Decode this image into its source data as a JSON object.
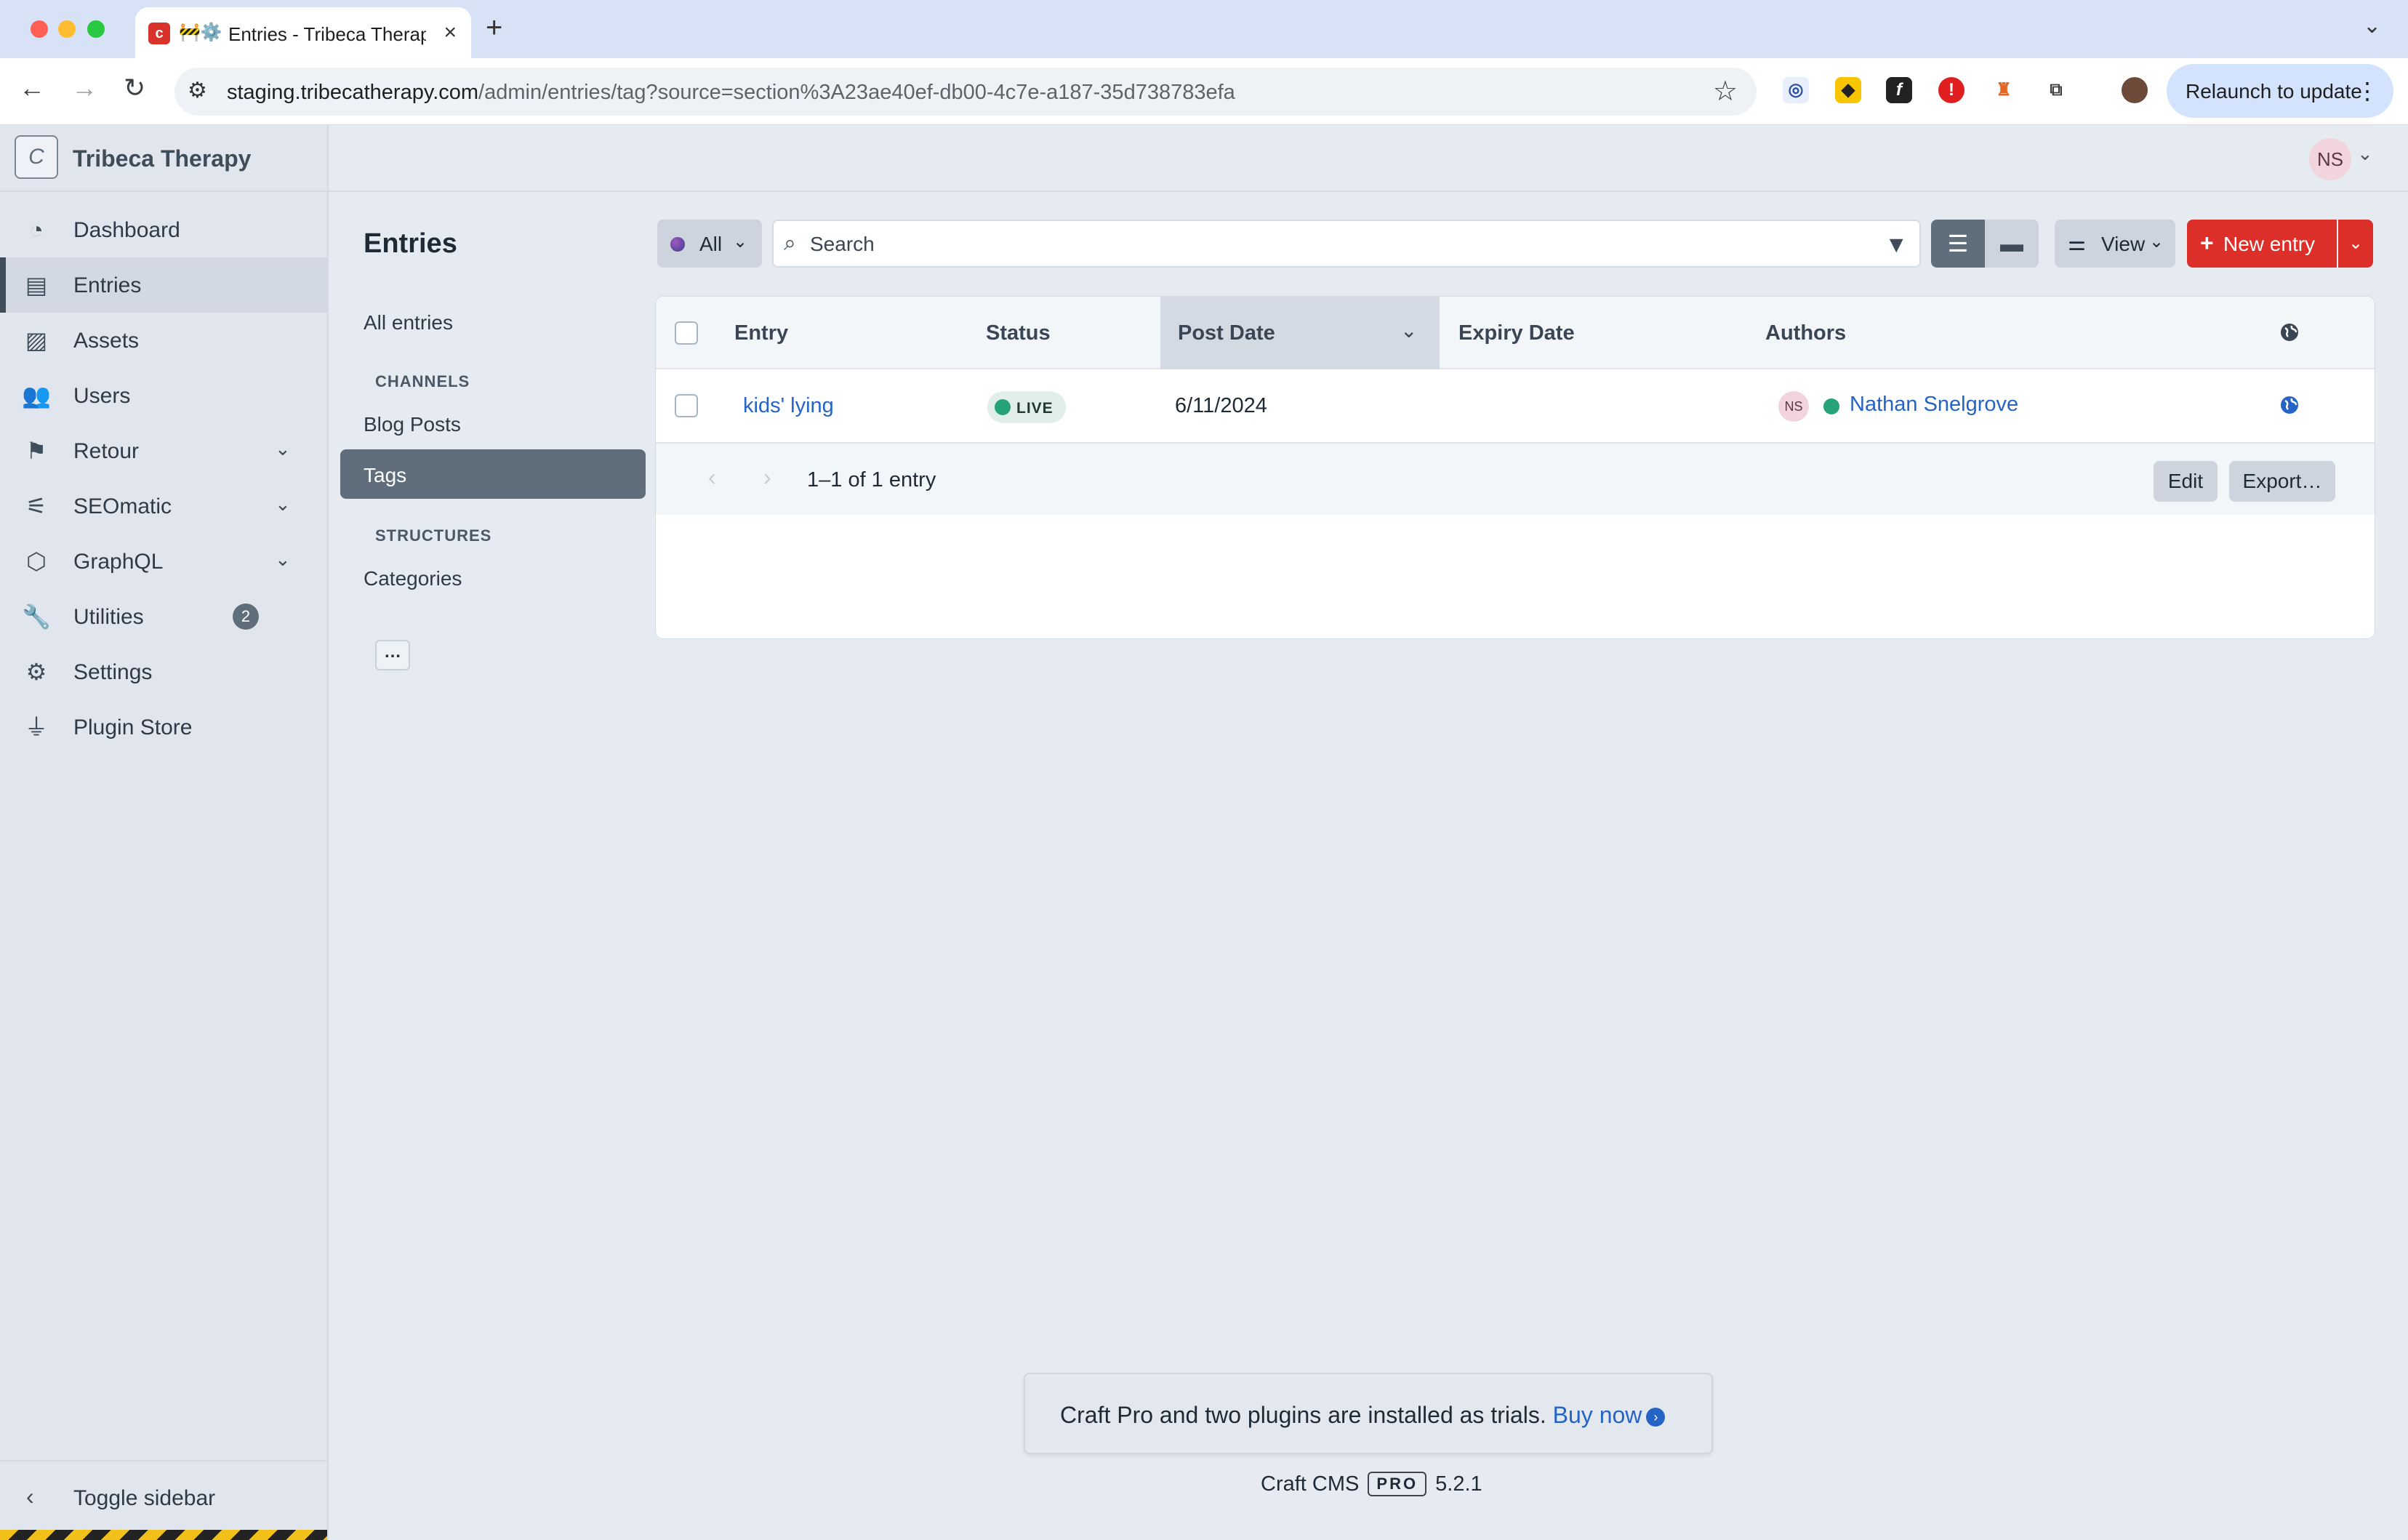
{
  "browser": {
    "tab_title": "Entries - Tribeca Therapy",
    "tab_prefix": "🚧⚙️",
    "url_host": "staging.tribecatherapy.com",
    "url_path": "/admin/entries/tag?source=section%3A23ae40ef-db00-4c7e-a187-35d738783efa",
    "relaunch_label": "Relaunch to update"
  },
  "sidebar": {
    "site_name": "Tribeca Therapy",
    "logo_letter": "C",
    "items": [
      {
        "label": "Dashboard",
        "icon": "dashboard-icon"
      },
      {
        "label": "Entries",
        "icon": "entries-icon",
        "active": true
      },
      {
        "label": "Assets",
        "icon": "image-icon"
      },
      {
        "label": "Users",
        "icon": "users-icon"
      },
      {
        "label": "Retour",
        "icon": "retour-icon",
        "expandable": true
      },
      {
        "label": "SEOmatic",
        "icon": "seomatic-icon",
        "expandable": true
      },
      {
        "label": "GraphQL",
        "icon": "graphql-icon",
        "expandable": true
      },
      {
        "label": "Utilities",
        "icon": "wrench-icon",
        "badge": "2"
      },
      {
        "label": "Settings",
        "icon": "gear-icon"
      },
      {
        "label": "Plugin Store",
        "icon": "plug-icon"
      }
    ],
    "toggle_label": "Toggle sidebar"
  },
  "header": {
    "user_initials": "NS"
  },
  "sources": {
    "title": "Entries",
    "all_entries": "All entries",
    "channels_heading": "CHANNELS",
    "blog_posts": "Blog Posts",
    "tags": "Tags",
    "structures_heading": "STRUCTURES",
    "categories": "Categories",
    "more": "…"
  },
  "toolbar": {
    "site_label": "All",
    "search_placeholder": "Search",
    "view_label": "View",
    "new_entry_label": "New entry"
  },
  "table": {
    "columns": [
      "Entry",
      "Status",
      "Post Date",
      "Expiry Date",
      "Authors"
    ],
    "rows": [
      {
        "entry": "kids' lying",
        "status": "LIVE",
        "post_date": "6/11/2024",
        "expiry_date": "",
        "author_initials": "NS",
        "author": "Nathan Snelgrove"
      }
    ],
    "pagination": "1–1 of 1 entry",
    "edit_label": "Edit",
    "export_label": "Export…"
  },
  "footer": {
    "trial_text": "Craft Pro and two plugins are installed as trials.",
    "buy_label": "Buy now",
    "cms_name": "Craft CMS",
    "edition": "PRO",
    "version": "5.2.1"
  },
  "colors": {
    "accent_red": "#dc2f2a",
    "link_blue": "#2563c5",
    "live_green": "#27a37a",
    "sidebar_bg": "#e1e6ee"
  }
}
